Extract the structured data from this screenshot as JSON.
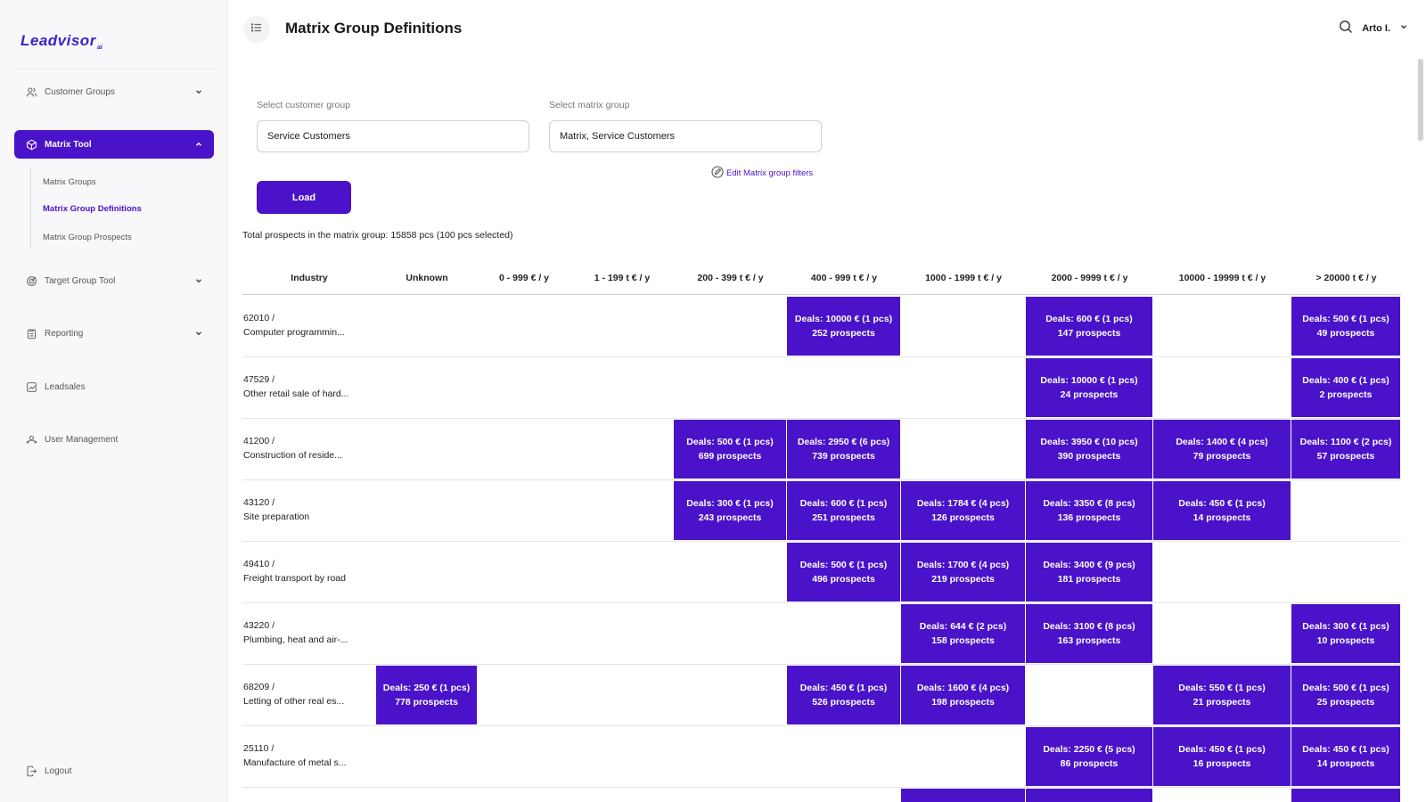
{
  "app": {
    "logo": "Leadvisor",
    "logo_sub": "ai"
  },
  "header": {
    "title": "Matrix Group Definitions",
    "user_name": "Arto I."
  },
  "sidebar": {
    "items": [
      {
        "label": "Customer Groups"
      },
      {
        "label": "Matrix Tool"
      },
      {
        "label": "Target Group Tool"
      },
      {
        "label": "Reporting"
      },
      {
        "label": "Leadsales"
      },
      {
        "label": "User Management"
      }
    ],
    "subitems": [
      {
        "label": "Matrix Groups"
      },
      {
        "label": "Matrix Group Definitions"
      },
      {
        "label": "Matrix Group Prospects"
      }
    ],
    "logout": "Logout"
  },
  "form": {
    "customer_group_label": "Select customer group",
    "customer_group_value": "Service Customers",
    "matrix_group_label": "Select matrix group",
    "matrix_group_value": "Matrix, Service Customers",
    "edit_link": "Edit Matrix group filters",
    "load_label": "Load",
    "total_text": "Total prospects in the matrix group: 15858 pcs (100 pcs selected)"
  },
  "matrix": {
    "columns": [
      "Industry",
      "Unknown",
      "0 - 999 € / y",
      "1 - 199 t € / y",
      "200 - 399 t € / y",
      "400 - 999 t € / y",
      "1000 - 1999 t € / y",
      "2000 - 9999 t € / y",
      "10000 - 19999 t € / y",
      "> 20000 t € / y"
    ],
    "rows": [
      {
        "code": "62010 /",
        "name": "Computer programmin...",
        "cells": [
          null,
          null,
          null,
          null,
          {
            "deals": "Deals: 10000 € (1 pcs)",
            "prospects": "252 prospects"
          },
          null,
          {
            "deals": "Deals: 600 € (1 pcs)",
            "prospects": "147 prospects"
          },
          null,
          {
            "deals": "Deals: 500 € (1 pcs)",
            "prospects": "49 prospects"
          }
        ]
      },
      {
        "code": "47529 /",
        "name": "Other retail sale of hard...",
        "cells": [
          null,
          null,
          null,
          null,
          null,
          null,
          {
            "deals": "Deals: 10000 € (1 pcs)",
            "prospects": "24 prospects"
          },
          null,
          {
            "deals": "Deals: 400 € (1 pcs)",
            "prospects": "2 prospects"
          }
        ]
      },
      {
        "code": "41200 /",
        "name": "Construction of reside...",
        "cells": [
          null,
          null,
          null,
          {
            "deals": "Deals: 500 € (1 pcs)",
            "prospects": "699 prospects"
          },
          {
            "deals": "Deals: 2950 € (6 pcs)",
            "prospects": "739 prospects"
          },
          null,
          {
            "deals": "Deals: 3950 € (10 pcs)",
            "prospects": "390 prospects"
          },
          {
            "deals": "Deals: 1400 € (4 pcs)",
            "prospects": "79 prospects"
          },
          {
            "deals": "Deals: 1100 € (2 pcs)",
            "prospects": "57 prospects"
          }
        ]
      },
      {
        "code": "43120 /",
        "name": "Site preparation",
        "cells": [
          null,
          null,
          null,
          {
            "deals": "Deals: 300 € (1 pcs)",
            "prospects": "243 prospects"
          },
          {
            "deals": "Deals: 600 € (1 pcs)",
            "prospects": "251 prospects"
          },
          {
            "deals": "Deals: 1784 € (4 pcs)",
            "prospects": "126 prospects"
          },
          {
            "deals": "Deals: 3350 € (8 pcs)",
            "prospects": "136 prospects"
          },
          {
            "deals": "Deals: 450 € (1 pcs)",
            "prospects": "14 prospects"
          },
          null
        ]
      },
      {
        "code": "49410 /",
        "name": "Freight transport by road",
        "cells": [
          null,
          null,
          null,
          null,
          {
            "deals": "Deals: 500 € (1 pcs)",
            "prospects": "496 prospects"
          },
          {
            "deals": "Deals: 1700 € (4 pcs)",
            "prospects": "219 prospects"
          },
          {
            "deals": "Deals: 3400 € (9 pcs)",
            "prospects": "181 prospects"
          },
          null,
          null
        ]
      },
      {
        "code": "43220 /",
        "name": "Plumbing, heat and air-...",
        "cells": [
          null,
          null,
          null,
          null,
          null,
          {
            "deals": "Deals: 644 € (2 pcs)",
            "prospects": "158 prospects"
          },
          {
            "deals": "Deals: 3100 € (8 pcs)",
            "prospects": "163 prospects"
          },
          null,
          {
            "deals": "Deals: 300 € (1 pcs)",
            "prospects": "10 prospects"
          }
        ]
      },
      {
        "code": "68209 /",
        "name": "Letting of other real es...",
        "cells": [
          {
            "deals": "Deals: 250 € (1 pcs)",
            "prospects": "778 prospects"
          },
          null,
          null,
          null,
          {
            "deals": "Deals: 450 € (1 pcs)",
            "prospects": "526 prospects"
          },
          {
            "deals": "Deals: 1600 € (4 pcs)",
            "prospects": "198 prospects"
          },
          null,
          {
            "deals": "Deals: 550 € (1 pcs)",
            "prospects": "21 prospects"
          },
          {
            "deals": "Deals: 500 € (1 pcs)",
            "prospects": "25 prospects"
          }
        ]
      },
      {
        "code": "25110 /",
        "name": "Manufacture of metal s...",
        "cells": [
          null,
          null,
          null,
          null,
          null,
          null,
          {
            "deals": "Deals: 2250 € (5 pcs)",
            "prospects": "86 prospects"
          },
          {
            "deals": "Deals: 450 € (1 pcs)",
            "prospects": "16 prospects"
          },
          {
            "deals": "Deals: 450 € (1 pcs)",
            "prospects": "14 prospects"
          }
        ]
      },
      {
        "code": "",
        "name": "",
        "cells": [
          null,
          null,
          null,
          null,
          null,
          {
            "deals": "",
            "prospects": ""
          },
          {
            "deals": "",
            "prospects": ""
          },
          null,
          {
            "deals": "",
            "prospects": ""
          }
        ]
      }
    ]
  },
  "colors": {
    "accent": "#4a12c9",
    "sidebar_bg": "#f8f8fa"
  }
}
